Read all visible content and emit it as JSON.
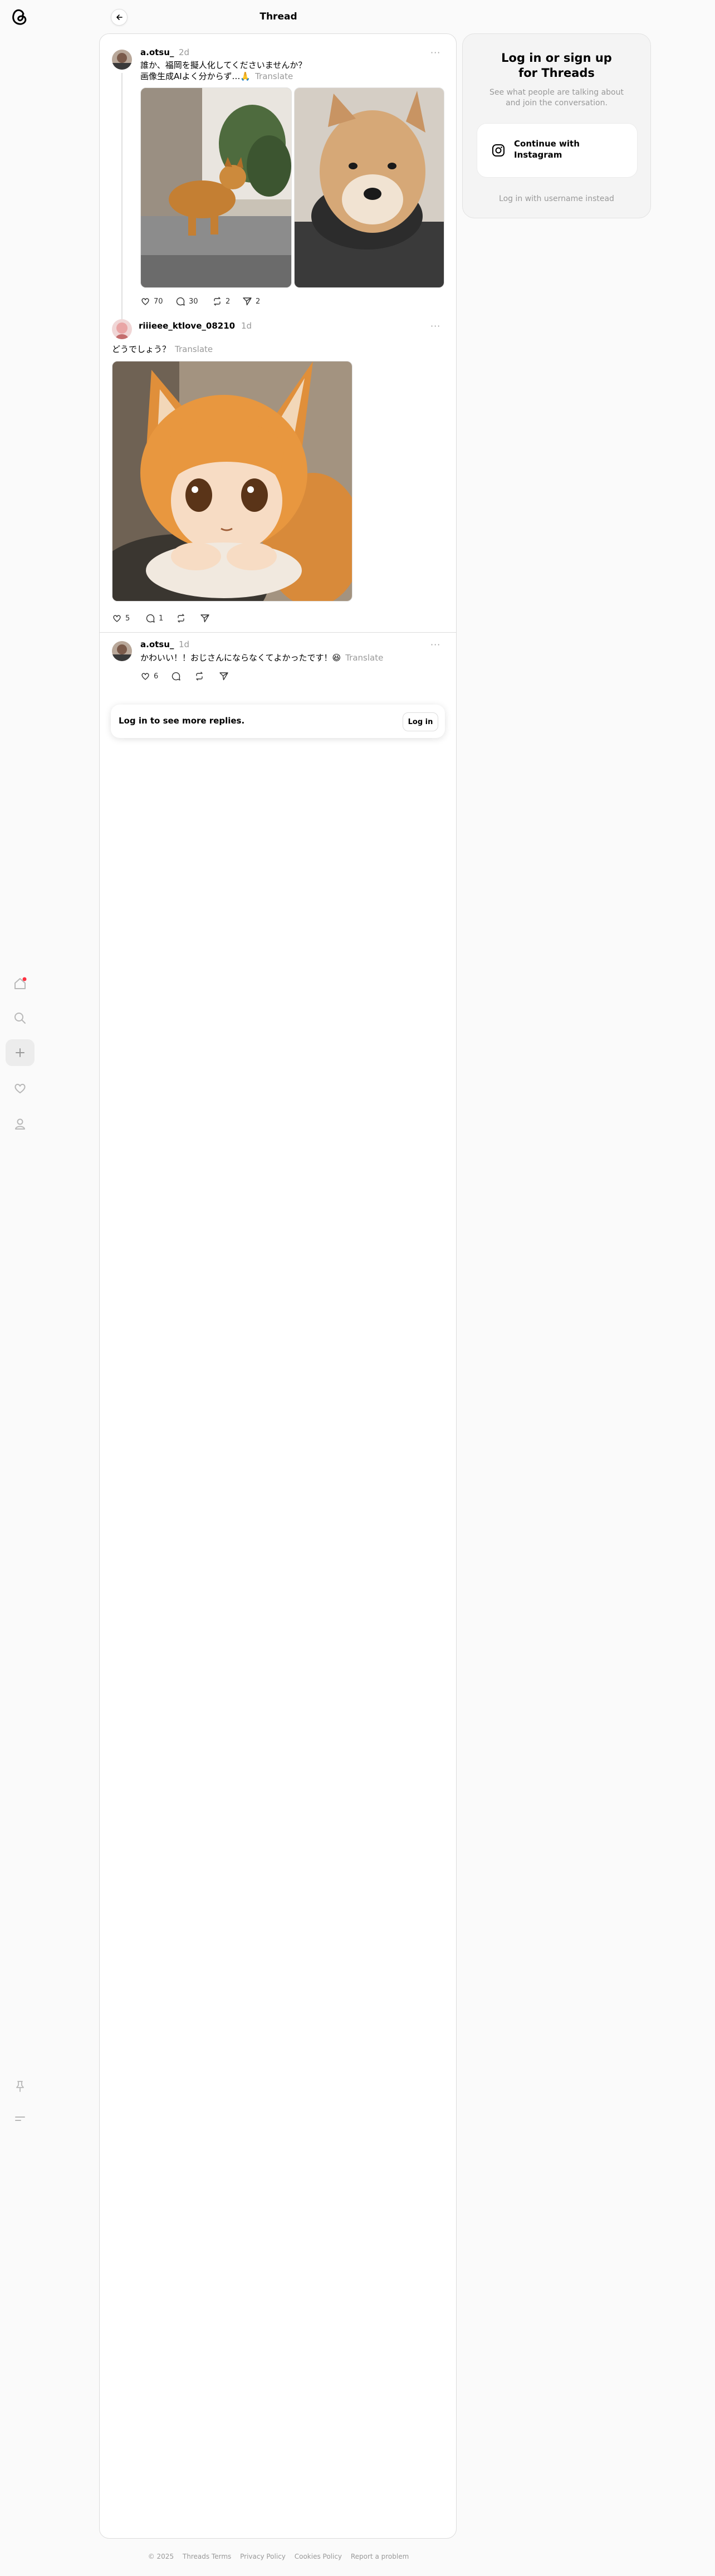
{
  "header": {
    "title": "Thread"
  },
  "nav": {
    "items": [
      {
        "name": "home"
      },
      {
        "name": "search"
      },
      {
        "name": "create"
      },
      {
        "name": "activity"
      },
      {
        "name": "profile"
      }
    ],
    "bottom": [
      "pin",
      "menu"
    ]
  },
  "post": {
    "username": "a.otsu_",
    "time": "2d",
    "text_line1": "誰か、福岡を擬人化してくださいませんか？",
    "text_line2": "画像生成AIよく分からず…🙏",
    "translate": "Translate",
    "likes": "70",
    "replies": "30",
    "reposts": "2",
    "shares": "2"
  },
  "reply1": {
    "username": "riiieee_ktlove_08210",
    "time": "1d",
    "text": "どうでしょう？",
    "translate": "Translate",
    "likes": "5",
    "replies": "1"
  },
  "reply2": {
    "username": "a.otsu_",
    "time": "1d",
    "text": "かわいい！！おじさんにならなくてよかったです！😆",
    "translate": "Translate",
    "likes": "6"
  },
  "more_replies": {
    "text": "Log in to see more replies.",
    "button": "Log in"
  },
  "login_panel": {
    "title_line1": "Log in or sign up",
    "title_line2": "for Threads",
    "subtitle_line1": "See what people are talking about",
    "subtitle_line2": "and join the conversation.",
    "ig_line1": "Continue with",
    "ig_line2": "Instagram",
    "username_link": "Log in with username instead"
  },
  "footer": {
    "copyright": "© 2025",
    "terms": "Threads Terms",
    "privacy": "Privacy Policy",
    "cookies": "Cookies Policy",
    "report": "Report a problem"
  },
  "colors": {
    "background": "#fafafa",
    "card": "#ffffff",
    "muted": "#999999",
    "notification_dot": "#ff3040"
  }
}
